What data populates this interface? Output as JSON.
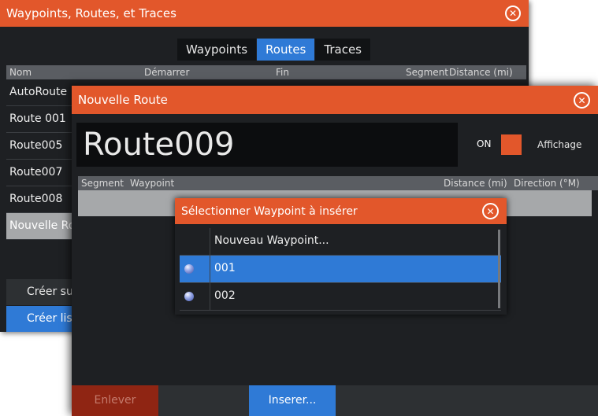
{
  "back_window": {
    "title": "Waypoints, Routes, et Traces",
    "tabs": [
      "Waypoints",
      "Routes",
      "Traces"
    ],
    "active_tab": "Routes",
    "columns": [
      "Nom",
      "Démarrer",
      "Fin",
      "Segment",
      "Distance (mi)"
    ],
    "routes": [
      "AutoRoute",
      "Route 001",
      "Route005",
      "Route007",
      "Route008",
      "Nouvelle Route"
    ],
    "selected_route": "Nouvelle Route",
    "buttons": [
      "Créer su",
      "Créer lis"
    ]
  },
  "route_window": {
    "title": "Nouvelle Route",
    "route_name": "Route009",
    "toggle_label": "ON",
    "display_label": "Affichage",
    "columns": [
      "Segment",
      "Waypoint",
      "Distance (mi)",
      "Direction (°M)"
    ],
    "buttons": {
      "remove": "Enlever",
      "insert": "Inserer..."
    }
  },
  "dialog": {
    "title": "Sélectionner Waypoint à insérer",
    "items": [
      "Nouveau Waypoint...",
      "001",
      "002"
    ],
    "selected_item": "001"
  },
  "colors": {
    "accent": "#e2572b",
    "selection": "#2f7ad6",
    "background": "#1e2023"
  }
}
